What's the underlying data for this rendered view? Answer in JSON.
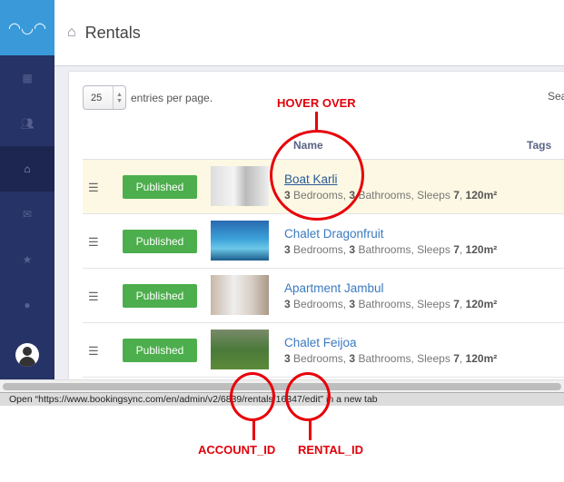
{
  "header": {
    "title": "Rentals"
  },
  "sidebar": {
    "items": [
      "calendar",
      "users",
      "home",
      "envelope",
      "star",
      "globe"
    ],
    "active": "home"
  },
  "table": {
    "page_size": "25",
    "entries_label": "entries per page.",
    "search_label": "Search",
    "columns": {
      "name": "Name",
      "tags": "Tags"
    },
    "rows": [
      {
        "status": "Published",
        "name": "Boat Karli",
        "bedrooms": "3",
        "bathrooms": "3",
        "sleeps": "7",
        "area": "120m²",
        "hovered": true
      },
      {
        "status": "Published",
        "name": "Chalet Dragonfruit",
        "bedrooms": "3",
        "bathrooms": "3",
        "sleeps": "7",
        "area": "120m²"
      },
      {
        "status": "Published",
        "name": "Apartment Jambul",
        "bedrooms": "3",
        "bathrooms": "3",
        "sleeps": "7",
        "area": "120m²"
      },
      {
        "status": "Published",
        "name": "Chalet Feijoa",
        "bedrooms": "3",
        "bathrooms": "3",
        "sleeps": "7",
        "area": "120m²"
      }
    ],
    "labels": {
      "bedrooms": "Bedrooms",
      "bathrooms": "Bathrooms",
      "sleeps": "Sleeps"
    }
  },
  "status_bar": {
    "text": "Open “https://www.bookingsync.com/en/admin/v2/6839/rentals/16347/edit” in a new tab"
  },
  "annotations": {
    "hover": "HOVER OVER",
    "account": "ACCOUNT_ID",
    "rental": "RENTAL_ID",
    "color": "#e8000a"
  }
}
